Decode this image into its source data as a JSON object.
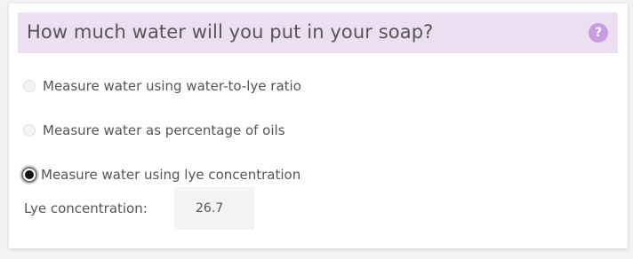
{
  "header": {
    "title": "How much water will you put in your soap?",
    "help_icon": "?"
  },
  "water_options": [
    {
      "label": "Measure water using water-to-lye ratio",
      "selected": false
    },
    {
      "label": "Measure water as percentage of oils",
      "selected": false
    },
    {
      "label": "Measure water using lye concentration",
      "selected": true
    }
  ],
  "lye_concentration": {
    "label": "Lye concentration:",
    "value": "26.7"
  },
  "colors": {
    "header_background": "#ecdff1",
    "help_icon": "#c99be3",
    "text": "#555555"
  }
}
